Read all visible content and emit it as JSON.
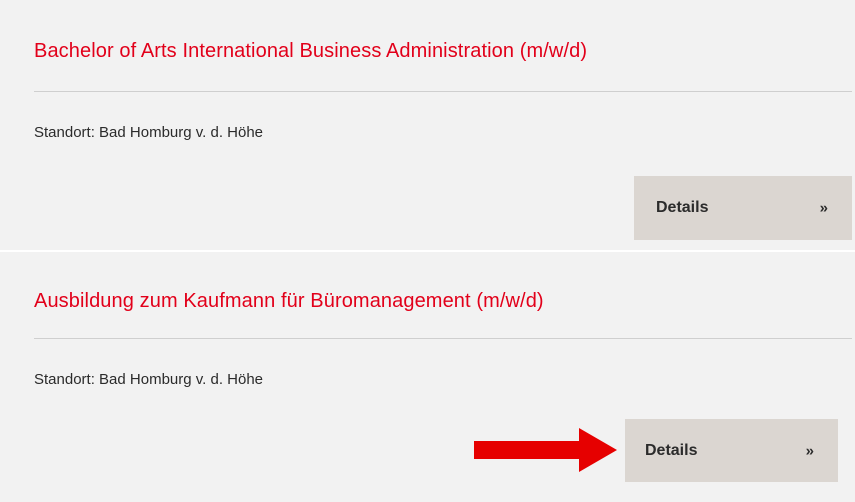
{
  "listings": [
    {
      "title": "Bachelor of Arts International Business Administration (m/w/d)",
      "location": "Standort: Bad Homburg v. d. Höhe",
      "details_label": "Details",
      "details_chevron": "»"
    },
    {
      "title": "Ausbildung zum Kaufmann für Büromanagement (m/w/d)",
      "location": "Standort: Bad Homburg v. d. Höhe",
      "details_label": "Details",
      "details_chevron": "»"
    }
  ],
  "annotation": {
    "icon": "right-arrow-icon",
    "color": "#e60000"
  },
  "colors": {
    "title": "#e2001a",
    "card_background": "#f2f2f2",
    "button_background": "#dbd6d1"
  }
}
